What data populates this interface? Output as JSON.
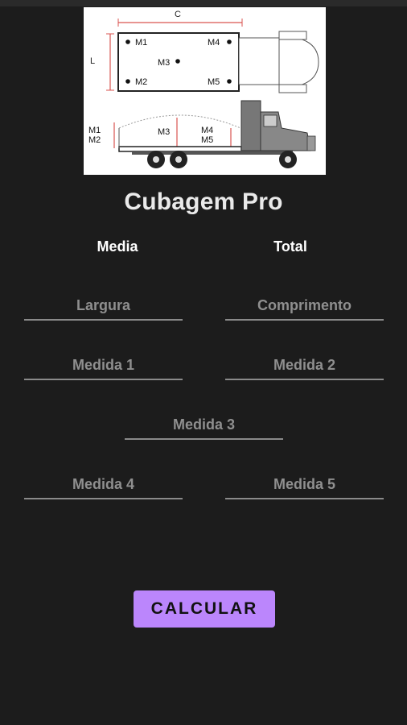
{
  "app_title": "Cubagem Pro",
  "tabs": [
    {
      "label": "Media"
    },
    {
      "label": "Total"
    }
  ],
  "fields": {
    "largura": {
      "placeholder": "Largura",
      "value": ""
    },
    "comprimento": {
      "placeholder": "Comprimento",
      "value": ""
    },
    "medida1": {
      "placeholder": "Medida 1",
      "value": ""
    },
    "medida2": {
      "placeholder": "Medida 2",
      "value": ""
    },
    "medida3": {
      "placeholder": "Medida 3",
      "value": ""
    },
    "medida4": {
      "placeholder": "Medida 4",
      "value": ""
    },
    "medida5": {
      "placeholder": "Medida 5",
      "value": ""
    }
  },
  "button": {
    "label": "CALCULAR",
    "color": "#bb86fc"
  },
  "diagram": {
    "label_c": "C",
    "label_l": "L",
    "top_points": [
      "M1",
      "M4",
      "M3",
      "M2",
      "M5"
    ],
    "side_labels": [
      "M1",
      "M2",
      "M3",
      "M4",
      "M5"
    ]
  }
}
